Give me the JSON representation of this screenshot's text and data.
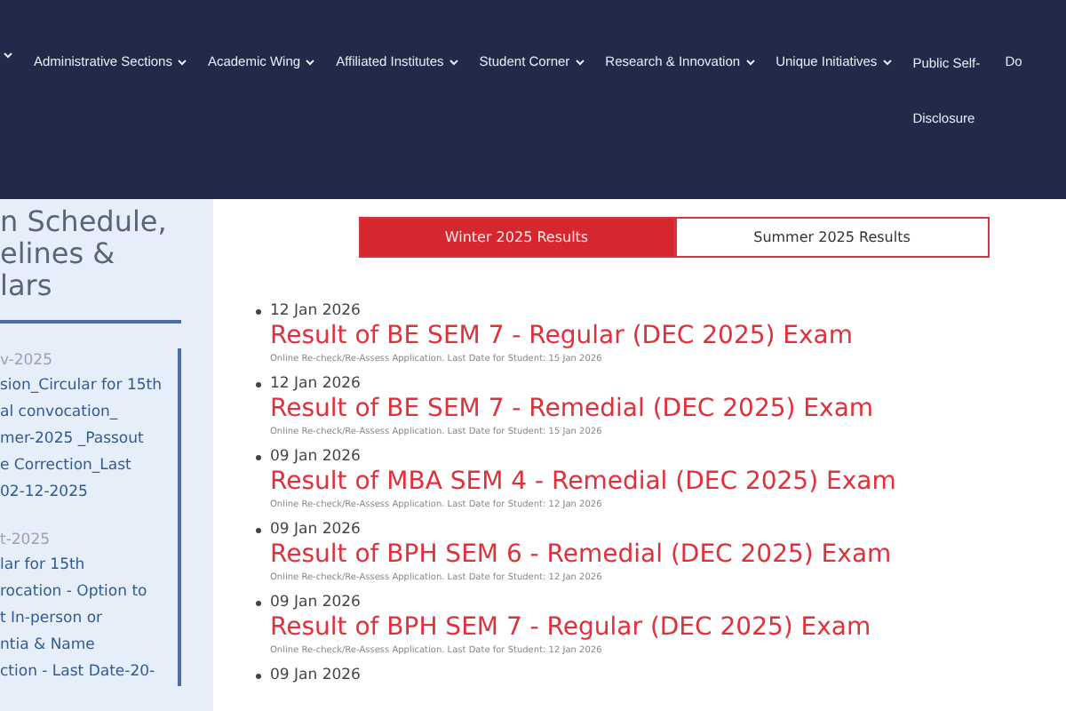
{
  "nav": {
    "items": [
      {
        "kind": "caret"
      },
      {
        "kind": "dropdown",
        "label": "Administrative Sections"
      },
      {
        "kind": "dropdown",
        "label": "Academic Wing"
      },
      {
        "kind": "dropdown",
        "label": "Affiliated Institutes"
      },
      {
        "kind": "dropdown",
        "label": "Student Corner"
      },
      {
        "kind": "dropdown",
        "label": "Research & Innovation"
      },
      {
        "kind": "dropdown",
        "label": "Unique Initiatives"
      },
      {
        "kind": "stacked",
        "label": "Public Self- Disclosure"
      },
      {
        "kind": "link",
        "label": "Do"
      }
    ]
  },
  "sidebar": {
    "heading_lines": [
      "n Schedule,",
      "elines &",
      "lars"
    ],
    "entries": [
      {
        "date": "v-2025",
        "lines": [
          "sion_Circular for 15th",
          "al convocation_",
          "mer-2025 _Passout",
          "e Correction_Last",
          "02-12-2025"
        ]
      },
      {
        "date": "t-2025",
        "lines": [
          "lar for 15th",
          "rocation - Option to",
          "t In-person or",
          "ntia & Name",
          "ction - Last Date-20-"
        ]
      }
    ]
  },
  "tabs": [
    {
      "label": "Winter 2025 Results",
      "selected": true
    },
    {
      "label": "Summer 2025 Results",
      "selected": false
    }
  ],
  "results": [
    {
      "date": "12 Jan 2026",
      "title": "Result of BE SEM 7 - Regular (DEC 2025) Exam",
      "note": "Online Re-check/Re-Assess Application. Last Date for Student: 15 Jan 2026"
    },
    {
      "date": "12 Jan 2026",
      "title": "Result of BE SEM 7 - Remedial (DEC 2025) Exam",
      "note": "Online Re-check/Re-Assess Application. Last Date for Student: 15 Jan 2026"
    },
    {
      "date": "09 Jan 2026",
      "title": "Result of MBA SEM 4 - Remedial (DEC 2025) Exam",
      "note": "Online Re-check/Re-Assess Application. Last Date for Student: 12 Jan 2026"
    },
    {
      "date": "09 Jan 2026",
      "title": "Result of BPH SEM 6 - Remedial (DEC 2025) Exam",
      "note": "Online Re-check/Re-Assess Application. Last Date for Student: 12 Jan 2026"
    },
    {
      "date": "09 Jan 2026",
      "title": "Result of BPH SEM 7 - Regular (DEC 2025) Exam",
      "note": "Online Re-check/Re-Assess Application. Last Date for Student: 12 Jan 2026"
    },
    {
      "date": "09 Jan 2026"
    }
  ]
}
